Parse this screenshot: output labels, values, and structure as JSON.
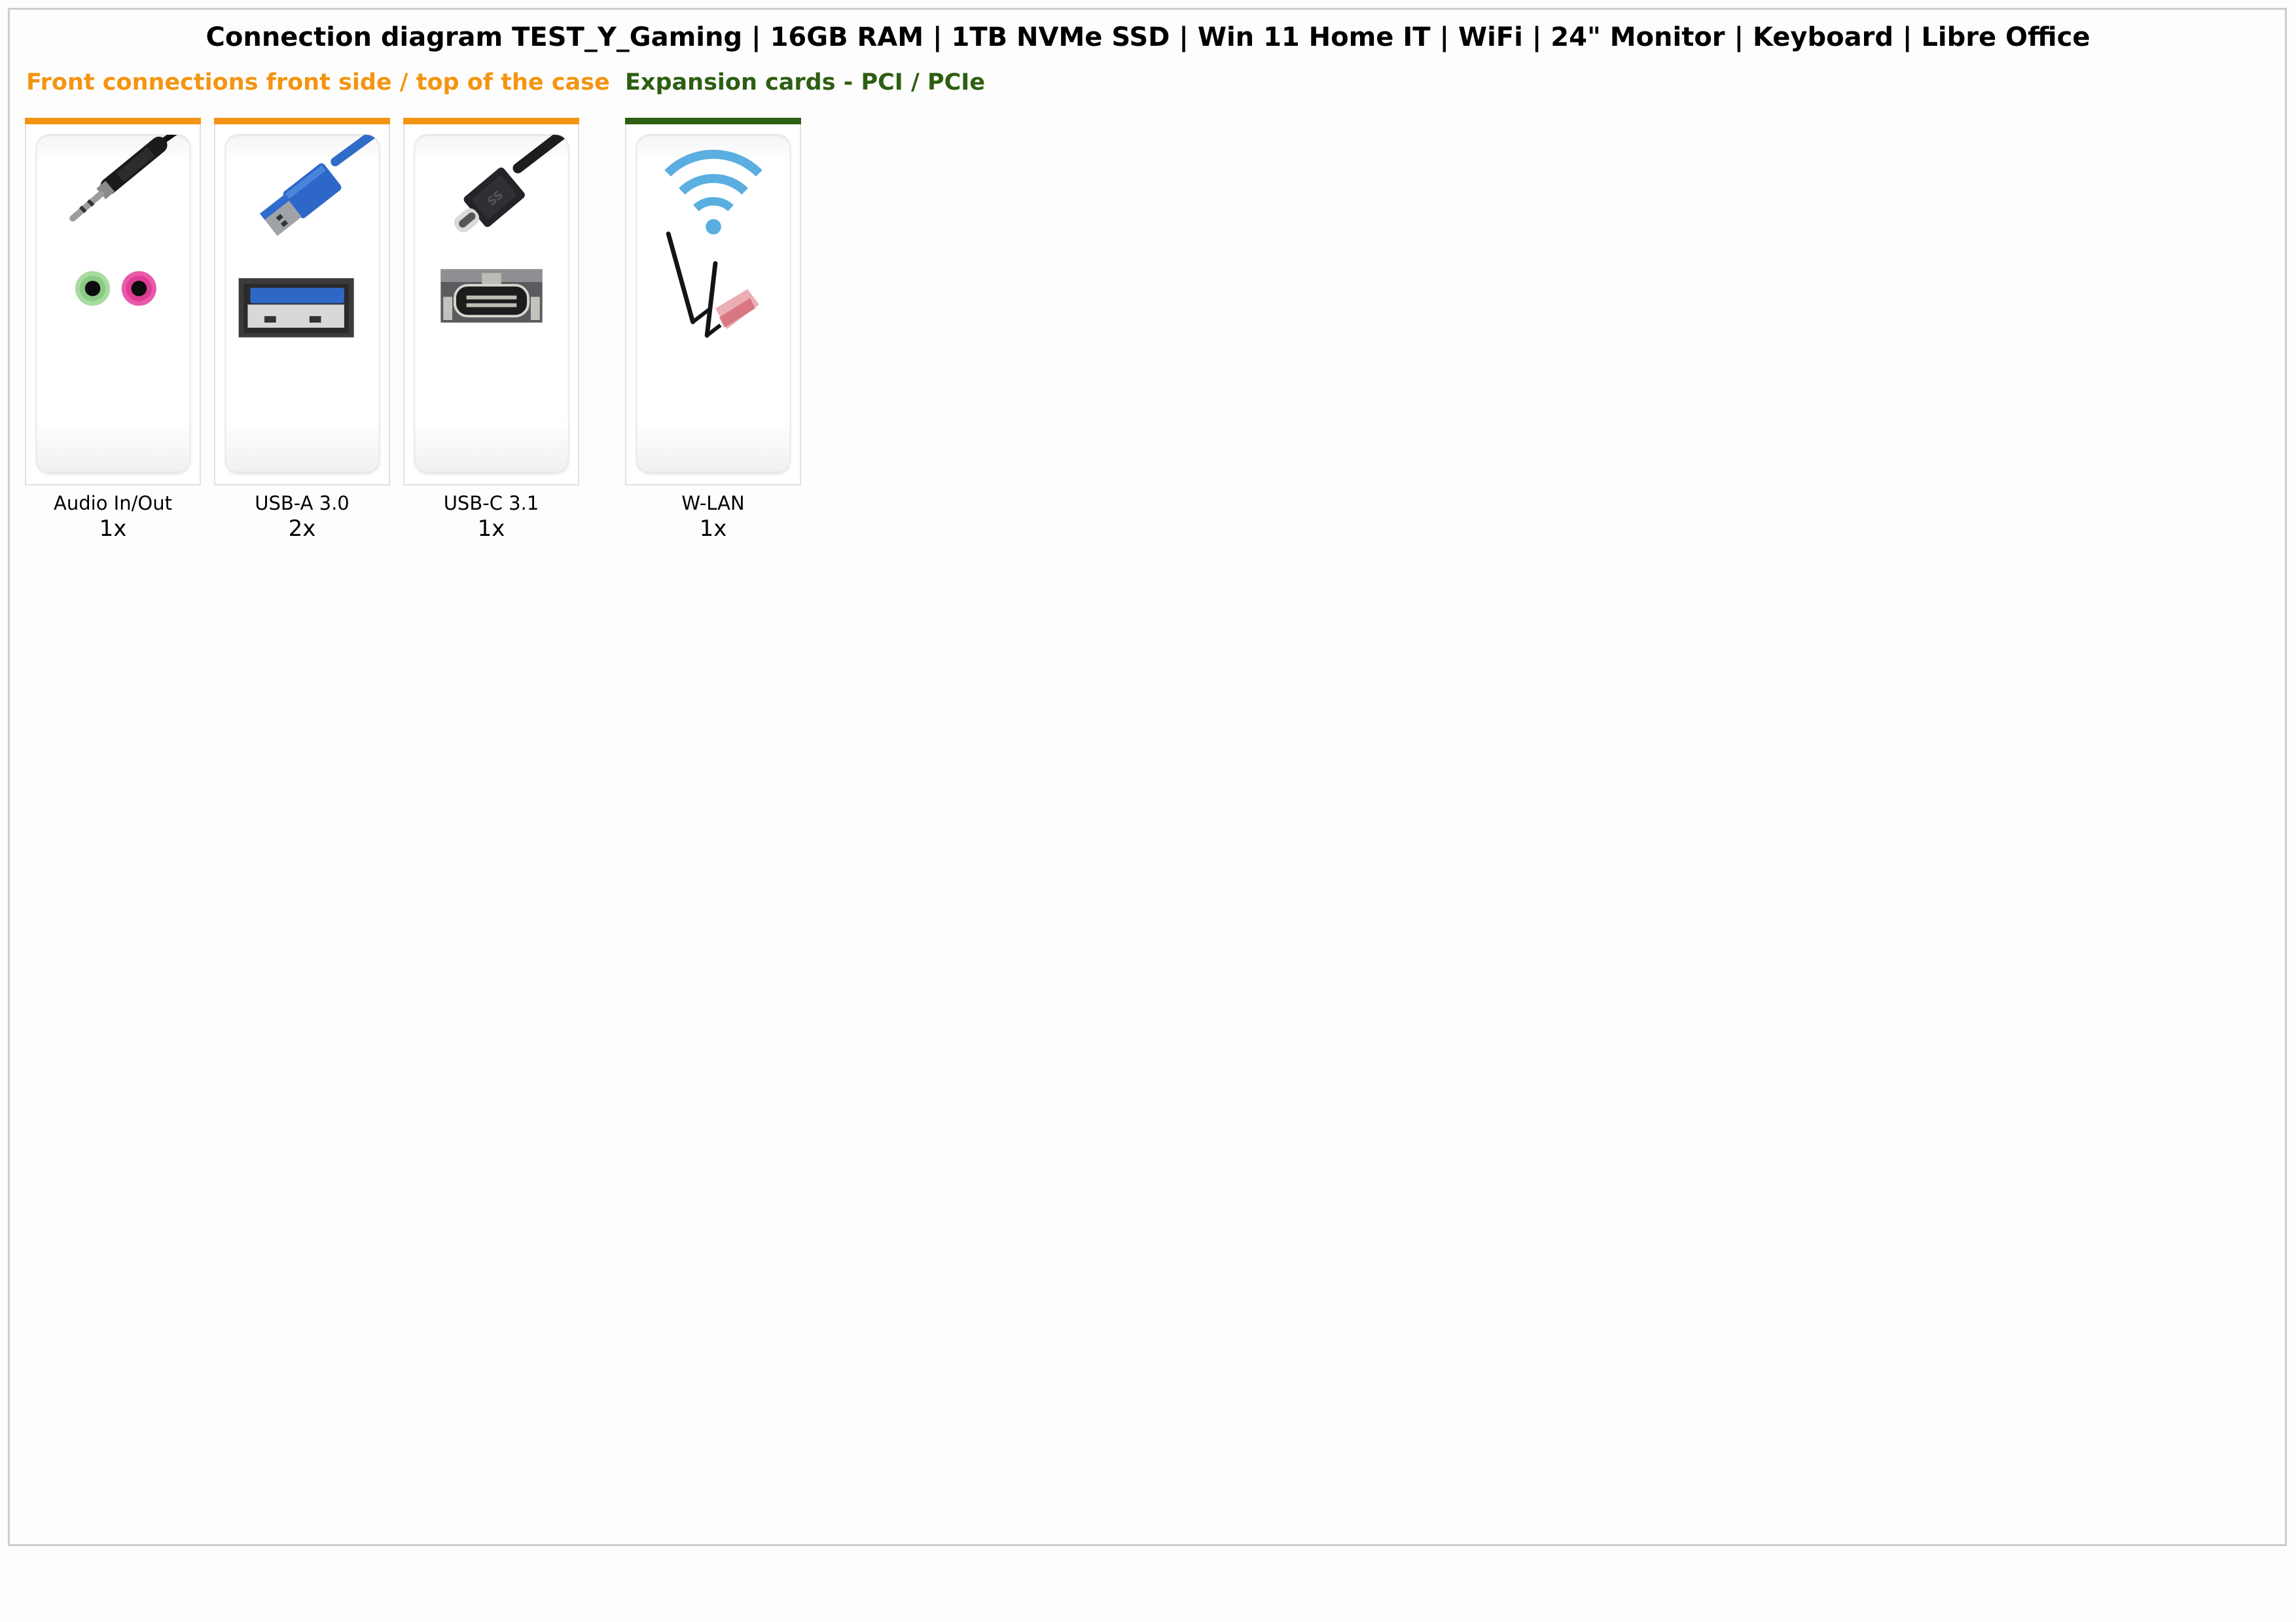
{
  "title": "Connection diagram TEST_Y_Gaming | 16GB RAM | 1TB NVMe SSD | Win 11 Home IT | WiFi | 24\" Monitor | Keyboard | Libre Office",
  "colors": {
    "front_accent": "#F39512",
    "expansion_accent": "#2D5F12",
    "wifi_blue": "#5AAEE0"
  },
  "sections": [
    {
      "heading": "Front connections front side / top of the case",
      "items": [
        {
          "label": "Audio In/Out",
          "count": "1x",
          "icon": "audio-jack-icon"
        },
        {
          "label": "USB-A 3.0",
          "count": "2x",
          "icon": "usb-a-icon"
        },
        {
          "label": "USB-C 3.1",
          "count": "1x",
          "icon": "usb-c-icon"
        }
      ]
    },
    {
      "heading": "Expansion cards - PCI / PCIe",
      "items": [
        {
          "label": "W-LAN",
          "count": "1x",
          "icon": "wifi-card-icon"
        }
      ]
    }
  ]
}
